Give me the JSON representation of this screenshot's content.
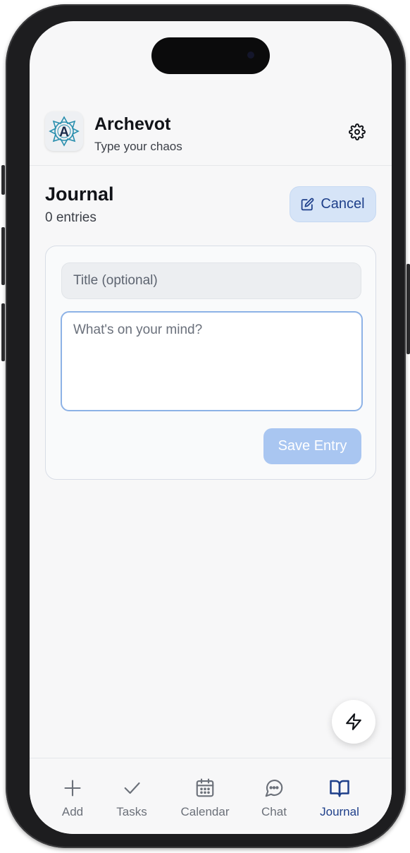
{
  "app": {
    "title": "Archevot",
    "subtitle": "Type your chaos",
    "logo_letter": "A",
    "logo_icon": "mandala-logo-icon",
    "settings_icon": "gear-icon"
  },
  "journal": {
    "title": "Journal",
    "entry_count": "0 entries",
    "cancel_label": "Cancel",
    "cancel_icon": "edit-icon"
  },
  "editor": {
    "title_placeholder": "Title (optional)",
    "body_placeholder": "What's on your mind?",
    "save_label": "Save Entry"
  },
  "fab": {
    "icon": "lightning-icon"
  },
  "nav": {
    "items": [
      {
        "label": "Add",
        "icon": "plus-icon",
        "active": false
      },
      {
        "label": "Tasks",
        "icon": "check-icon",
        "active": false
      },
      {
        "label": "Calendar",
        "icon": "calendar-icon",
        "active": false
      },
      {
        "label": "Chat",
        "icon": "chat-icon",
        "active": false
      },
      {
        "label": "Journal",
        "icon": "book-icon",
        "active": true
      }
    ]
  },
  "colors": {
    "accent": "#1e3f8a",
    "accent_soft": "#d6e4f7",
    "save_disabled": "#a9c6f1",
    "logo_teal": "#2a8fae"
  }
}
